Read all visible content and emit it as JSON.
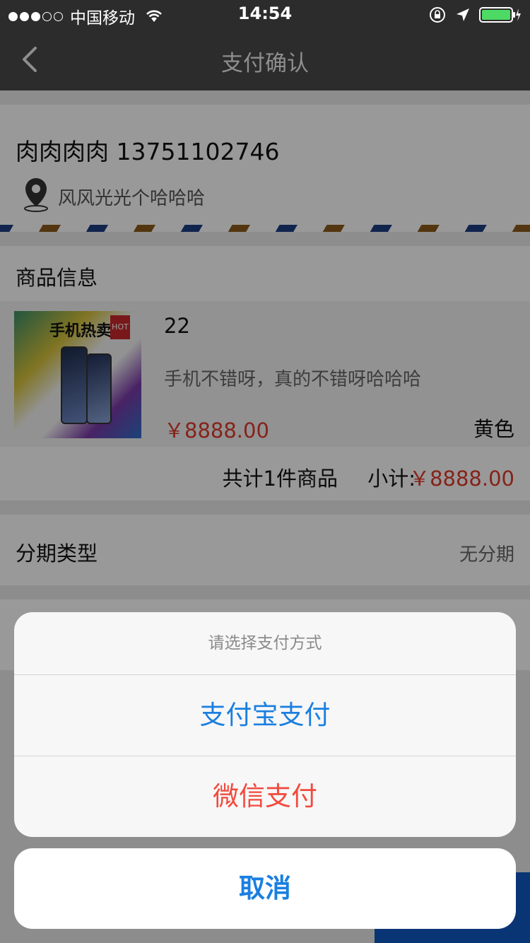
{
  "status_bar": {
    "carrier": "中国移动",
    "time": "14:54",
    "signal_bars": 3,
    "signal_total": 5,
    "battery_level": 1.0
  },
  "nav": {
    "title": "支付确认",
    "back_icon": "chevron-left-icon"
  },
  "address": {
    "name_phone": "肉肉肉肉 13751102746",
    "detail": "风风光光个哈哈哈",
    "icon": "location-pin-icon"
  },
  "goods": {
    "section_title": "商品信息",
    "item": {
      "image_banner": "手机热卖",
      "image_hot_badge": "HOT",
      "name": "22",
      "description": "手机不错呀，真的不错呀哈哈哈",
      "price": "￥8888.00",
      "spec": "黄色"
    },
    "total_count": "共计1件商品",
    "subtotal_label": "小计:",
    "subtotal_amount": "￥8888.00"
  },
  "installment": {
    "label": "分期类型",
    "value": "无分期"
  },
  "action_sheet": {
    "title": "请选择支付方式",
    "options": [
      {
        "label": "支付宝支付",
        "color": "#1a7fe0"
      },
      {
        "label": "微信支付",
        "color": "#f24a3e"
      }
    ],
    "cancel_label": "取消"
  },
  "colors": {
    "nav_bg": "#2c2c2c",
    "price_red": "#e03a2a",
    "accent_blue": "#1a7fe0",
    "bottom_button_blue": "#1259c4",
    "battery_green": "#4cd964"
  }
}
